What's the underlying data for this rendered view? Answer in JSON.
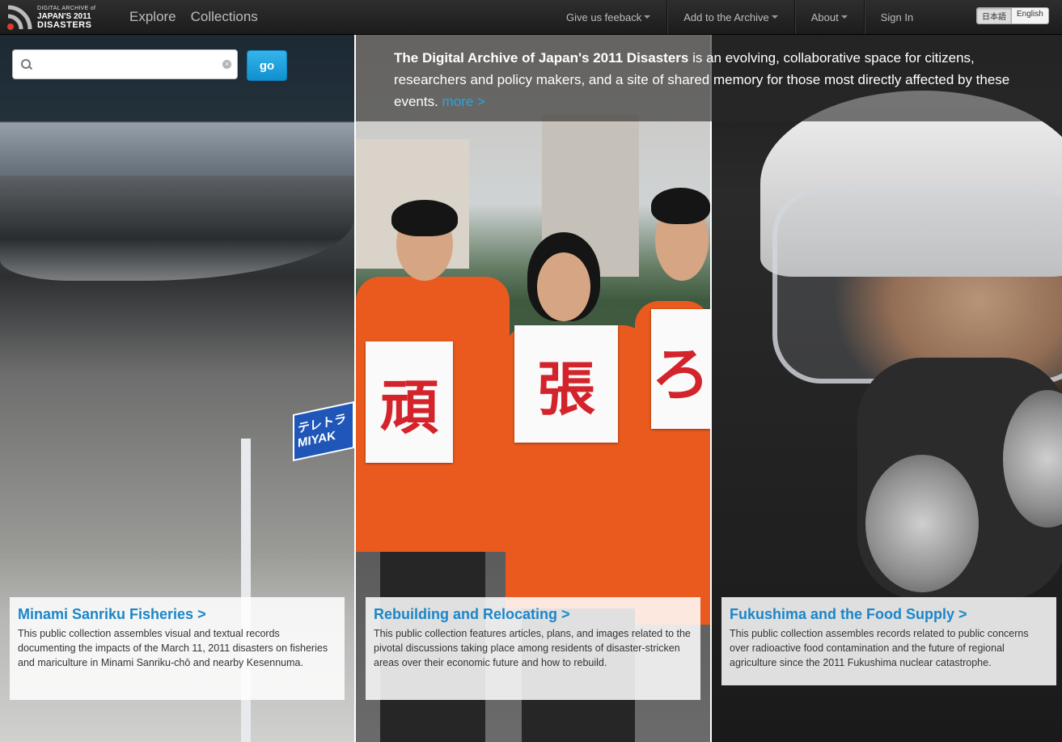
{
  "logo": {
    "line1": "DIGITAL ARCHIVE of",
    "line2": "JAPAN'S 2011",
    "line3": "DISASTERS"
  },
  "nav": {
    "left": [
      "Explore",
      "Collections"
    ],
    "right": [
      "Give us feeback",
      "Add to the Archive",
      "About",
      "Sign In"
    ],
    "lang": [
      "日本語",
      "English"
    ]
  },
  "search": {
    "value": "",
    "placeholder": "",
    "button": "go"
  },
  "intro": {
    "title": "The Digital Archive of Japan's 2011 Disasters",
    "text": " is an evolving, collaborative space for citizens, researchers and policy makers, and a site of shared memory for those most directly affected by these events. ",
    "more": "more >"
  },
  "photo_text": {
    "road_sign": "テレトラ MIYAK",
    "sign1": "頑",
    "sign2": "張",
    "sign3": "ろ"
  },
  "collections": [
    {
      "title": "Minami Sanriku Fisheries >",
      "description": "This public collection assembles visual and textual records documenting the impacts of the March 11, 2011 disasters on fisheries and mariculture in Minami Sanriku-chō and nearby Kesennuma."
    },
    {
      "title": "Rebuilding and Relocating >",
      "description": "This public collection features articles, plans, and images related to the pivotal discussions taking place among residents of disaster-stricken areas over their economic future and how to rebuild."
    },
    {
      "title": "Fukushima and the Food Supply >",
      "description": "This public collection assembles records related to public concerns over radioactive food contamination and the future of regional agriculture since the 2011 Fukushima nuclear catastrophe."
    }
  ],
  "colors": {
    "accent": "#1b86c9",
    "go_button": "#1aa0dc",
    "navbar": "#262626",
    "shirt": "#ea5a1e"
  }
}
